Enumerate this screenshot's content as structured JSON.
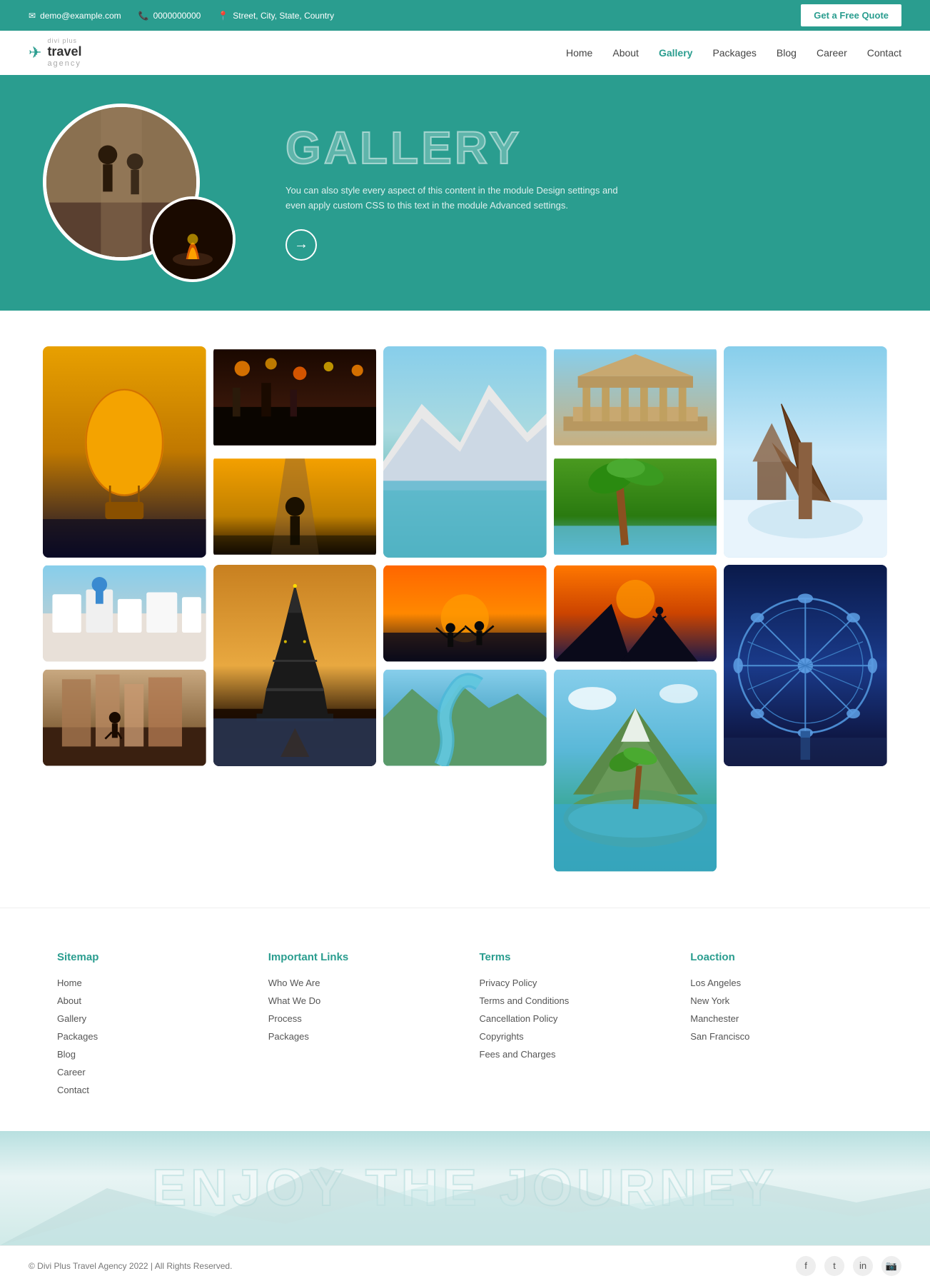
{
  "topbar": {
    "email": "demo@example.com",
    "phone": "0000000000",
    "address": "Street, City, State, Country",
    "quote_btn": "Get a Free Quote"
  },
  "navbar": {
    "logo_divi": "divi plus",
    "logo_travel": "travel",
    "logo_agency": "agency",
    "links": [
      {
        "label": "Home",
        "active": false
      },
      {
        "label": "About",
        "active": false
      },
      {
        "label": "Gallery",
        "active": true
      },
      {
        "label": "Packages",
        "active": false
      },
      {
        "label": "Blog",
        "active": false
      },
      {
        "label": "Career",
        "active": false
      },
      {
        "label": "Contact",
        "active": false
      }
    ]
  },
  "hero": {
    "title": "GALLERY",
    "subtitle": "You can also style every aspect of this content in the module Design settings and even apply custom CSS to this text in the module Advanced settings.",
    "arrow": "→"
  },
  "gallery": {
    "items": [
      {
        "id": 1,
        "label": "Hot Air Balloon",
        "style": "balloon"
      },
      {
        "id": 2,
        "label": "City Night Street",
        "style": "citynight"
      },
      {
        "id": 3,
        "label": "Mountain Lake",
        "style": "mountain"
      },
      {
        "id": 4,
        "label": "Ancient Temple",
        "style": "temple"
      },
      {
        "id": 5,
        "label": "Snow Winter",
        "style": "snow"
      },
      {
        "id": 6,
        "label": "Road Walk",
        "style": "road"
      },
      {
        "id": 7,
        "label": "Tropical",
        "style": "tropical"
      },
      {
        "id": 8,
        "label": "White Village",
        "style": "whiteville"
      },
      {
        "id": 9,
        "label": "Eiffel Tower",
        "style": "eiffel"
      },
      {
        "id": 10,
        "label": "Sunset People",
        "style": "sunset-people"
      },
      {
        "id": 11,
        "label": "Cliff Silhouette",
        "style": "cliff-silhouette"
      },
      {
        "id": 12,
        "label": "London Eye",
        "style": "london-eye"
      },
      {
        "id": 13,
        "label": "Street Walk",
        "style": "street2"
      },
      {
        "id": 14,
        "label": "Aerial View",
        "style": "aerial"
      },
      {
        "id": 15,
        "label": "Island",
        "style": "island"
      }
    ]
  },
  "footer": {
    "sitemap_title": "Sitemap",
    "sitemap_links": [
      "Home",
      "About",
      "Gallery",
      "Packages",
      "Blog",
      "Career",
      "Contact"
    ],
    "important_title": "Important Links",
    "important_links": [
      "Who We Are",
      "What We Do",
      "Process",
      "Packages"
    ],
    "terms_title": "Terms",
    "terms_links": [
      "Privacy Policy",
      "Terms and Conditions",
      "Cancellation Policy",
      "Copyrights",
      "Fees and Charges"
    ],
    "location_title": "Loaction",
    "location_links": [
      "Los Angeles",
      "New York",
      "Manchester",
      "San Francisco"
    ],
    "bottom_text": "ENJOY THE JOURNEY",
    "copyright": "© Divi Plus Travel Agency 2022 | All Rights Reserved.",
    "social": [
      "f",
      "t",
      "in",
      "ig"
    ]
  }
}
